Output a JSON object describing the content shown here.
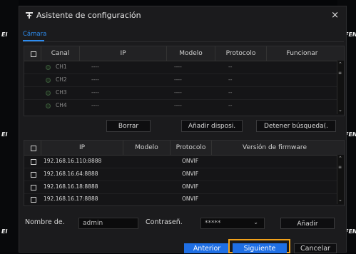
{
  "dialog": {
    "title": "Asistente de configuración",
    "close_label": "×"
  },
  "tab": {
    "label": "Cámara"
  },
  "device_table": {
    "headers": [
      "Canal",
      "IP",
      "Modelo",
      "Protocolo",
      "Funcionar"
    ],
    "rows": [
      {
        "channel": "CH1",
        "ip": "----",
        "model": "----",
        "protocol": "--"
      },
      {
        "channel": "CH2",
        "ip": "----",
        "model": "----",
        "protocol": "--"
      },
      {
        "channel": "CH3",
        "ip": "----",
        "model": "----",
        "protocol": "--"
      },
      {
        "channel": "CH4",
        "ip": "----",
        "model": "----",
        "protocol": "--"
      }
    ]
  },
  "actions": {
    "delete": "Borrar",
    "add_device": "Añadir disposi.",
    "stop_search": "Detener búsqueda(."
  },
  "search_table": {
    "headers": [
      "IP",
      "Modelo",
      "Protocolo",
      "Versión de firmware"
    ],
    "rows": [
      {
        "ip": "192.168.16.110:8888",
        "model": "",
        "protocol": "ONVIF",
        "firmware": ""
      },
      {
        "ip": "192.168.16.64:8888",
        "model": "",
        "protocol": "ONVIF",
        "firmware": ""
      },
      {
        "ip": "192.168.16.18:8888",
        "model": "",
        "protocol": "ONVIF",
        "firmware": ""
      },
      {
        "ip": "192.168.16.17:8888",
        "model": "",
        "protocol": "ONVIF",
        "firmware": ""
      }
    ]
  },
  "credentials": {
    "username_label": "Nombre de.",
    "username_value": "admin",
    "password_label": "Contraseñ.",
    "password_value": "*****",
    "add_label": "Añadir"
  },
  "footer": {
    "previous": "Anterior",
    "next": "Siguiente",
    "cancel": "Cancelar"
  },
  "background": {
    "edge_texts": [
      "EI",
      "FEN",
      "EI",
      "FEN",
      "EI",
      "FEN"
    ]
  },
  "colors": {
    "accent": "#1f6fe5",
    "highlight": "#f2a21b"
  }
}
